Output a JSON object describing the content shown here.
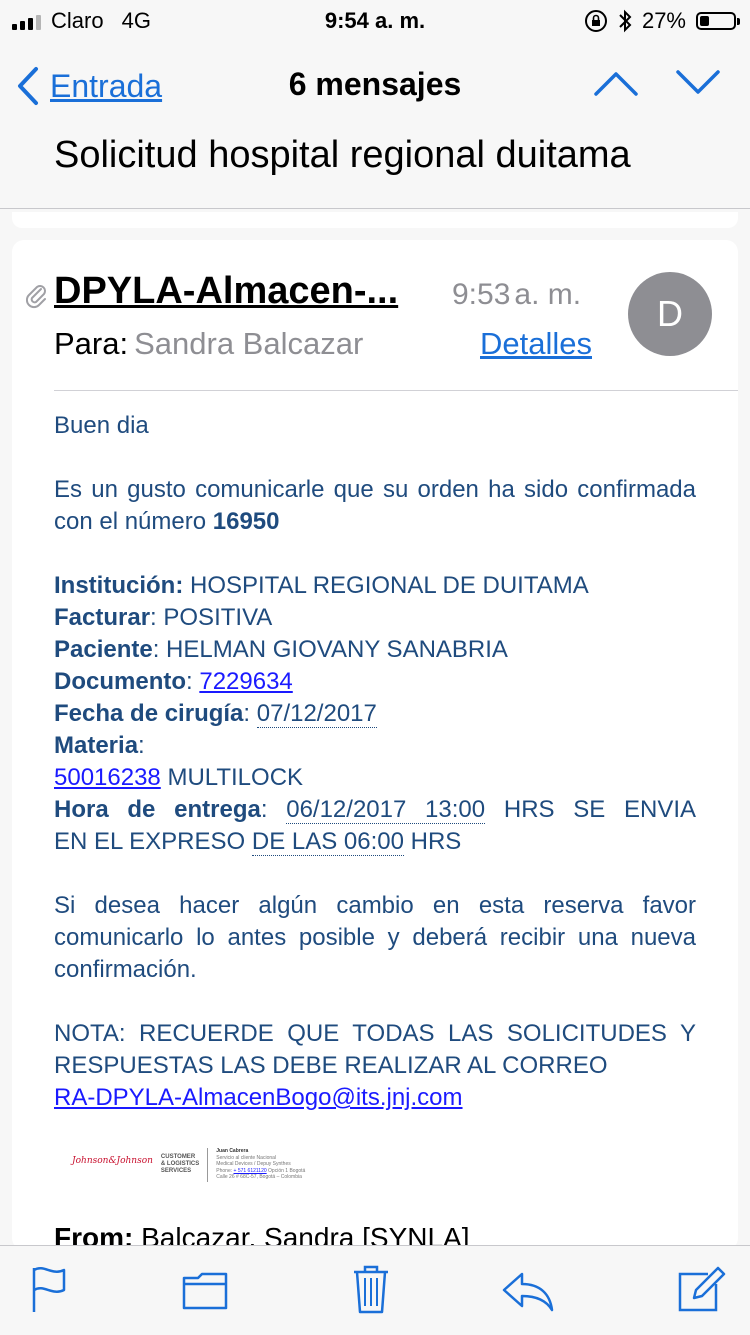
{
  "status_bar": {
    "carrier": "Claro",
    "network": "4G",
    "time": "9:54 a. m.",
    "battery_percent": "27%",
    "battery_level": 0.27
  },
  "nav": {
    "back_label": "Entrada",
    "message_count": "6 mensajes",
    "subject": "Solicitud hospital regional duitama"
  },
  "message": {
    "sender": "DPYLA-Almacen-...",
    "time": "9:53",
    "time_suffix": "a. m.",
    "avatar_initial": "D",
    "to_label": "Para:",
    "to_name": "Sandra Balcazar",
    "details_label": "Detalles"
  },
  "body": {
    "greeting": "Buen dia",
    "confirm_text": "Es un gusto comunicarle que su orden ha sido confirmada con el número",
    "order_number": "16950",
    "institucion_label": "Institución:",
    "institucion_value": "HOSPITAL REGIONAL DE DUITAMA",
    "facturar_label": "Facturar",
    "facturar_value": ": POSITIVA",
    "paciente_label": "Paciente",
    "paciente_value": ": HELMAN GIOVANY SANABRIA",
    "documento_label": "Documento",
    "documento_value": "7229634",
    "fecha_label": "Fecha de cirugía",
    "fecha_value": "07/12/2017",
    "materia_label": "Materia",
    "materia_code": "50016238",
    "materia_name": "MULTILOCK",
    "hora_label": "Hora de entrega",
    "hora_value": "06/12/2017 13:00",
    "hora_rest": "HRS SE ENVIA",
    "hora_line2_a": "EN EL EXPRESO",
    "hora_line2_b": "DE LAS 06:00",
    "hora_line2_c": "HRS",
    "cambio_text": "Si desea hacer algún cambio en esta reserva favor comunicarlo lo antes posible y deberá recibir una nueva confirmación.",
    "nota_text": "NOTA: RECUERDE QUE TODAS LAS SOLICITUDES Y RESPUESTAS LAS DEBE REALIZAR AL CORREO",
    "email": "RA-DPYLA-AlmacenBogo@its.jnj.com"
  },
  "signature": {
    "logo_text": "Johnson&Johnson",
    "division_1": "CUSTOMER",
    "division_2": "& LOGISTICS",
    "division_3": "SERVICES",
    "name": "Juan Cabrera",
    "line1": "Servicio al cliente Nacional",
    "line2": "Medical Devices / Depuy Synthes",
    "phone_label": "Phone:",
    "phone": "+ 571 6121120",
    "phone_rest": "Opción 1 Bogotá",
    "address": "Calle 26 # 68C-57, Bogotá – Colombia"
  },
  "quoted": {
    "from_label": "From:",
    "from_value": "Balcazar, Sandra [SYNLA]"
  },
  "toolbar": {
    "items": [
      "flag-icon",
      "folder-icon",
      "trash-icon",
      "reply-icon",
      "compose-icon"
    ]
  },
  "colors": {
    "accent": "#1a6fd8",
    "body_text": "#1f4b7e",
    "link": "#1a1aff"
  }
}
